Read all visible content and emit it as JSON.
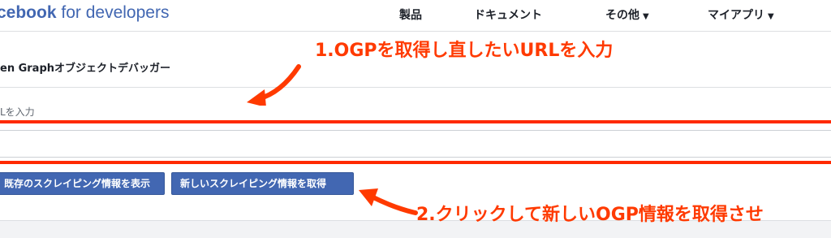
{
  "brand": {
    "name_bold": "cebook",
    "name_light": " for developers"
  },
  "nav": {
    "products": "製品",
    "docs": "ドキュメント",
    "other": "その他",
    "myapps": "マイアプリ",
    "caret": "▼"
  },
  "page": {
    "section_title": "en Graphオブジェクトデバッガー",
    "field_label": "Lを入力",
    "url_value": ""
  },
  "buttons": {
    "show_existing": "既存のスクレイピング情報を表示",
    "fetch_new": "新しいスクレイピング情報を取得"
  },
  "annotations": {
    "step1": "1.OGPを取得し直したいURLを入力",
    "step2": "2.クリックして新しいOGP情報を取得させ"
  },
  "colors": {
    "brand": "#4267b2",
    "annotation": "#ff3a00",
    "button": "#4267b2"
  }
}
